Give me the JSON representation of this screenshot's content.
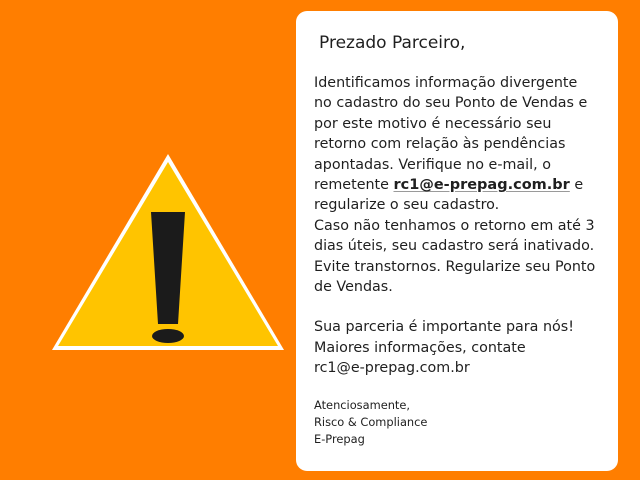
{
  "warning": {
    "icon": "warning-icon",
    "triangle_fill": "#ffc400",
    "outline": "#ffffff",
    "mark": "#1b1b1b"
  },
  "message": {
    "greeting": "Prezado Parceiro,",
    "paragraph_1": {
      "line_1": "Identificamos informação divergente",
      "line_2": "no cadastro do seu Ponto de Vendas e",
      "line_3": "por este motivo é necessário seu",
      "line_4": "retorno com relação às pendências",
      "line_5": "apontadas. Verifique no e-mail, o",
      "line_6_prefix": "remetente ",
      "line_6_link": "rc1@e-prepag.com.br",
      "line_6_suffix": " e",
      "line_7": "regularize o seu cadastro.",
      "line_8": "Caso não tenhamos o retorno em até 3",
      "line_9": "dias úteis, seu cadastro será inativado.",
      "line_10": "Evite transtornos. Regularize seu Ponto",
      "line_11": "de Vendas."
    },
    "paragraph_2": {
      "line_1": "Sua parceria é importante para nós!",
      "line_2": "Maiores informações, contate",
      "line_3": "rc1@e-prepag.com.br"
    },
    "signature": {
      "line_1": "Atenciosamente,",
      "line_2": "Risco & Compliance",
      "line_3": "E-Prepag"
    }
  },
  "colors": {
    "background": "#ff7e00",
    "card": "#ffffff",
    "text": "#1f1f1f"
  }
}
